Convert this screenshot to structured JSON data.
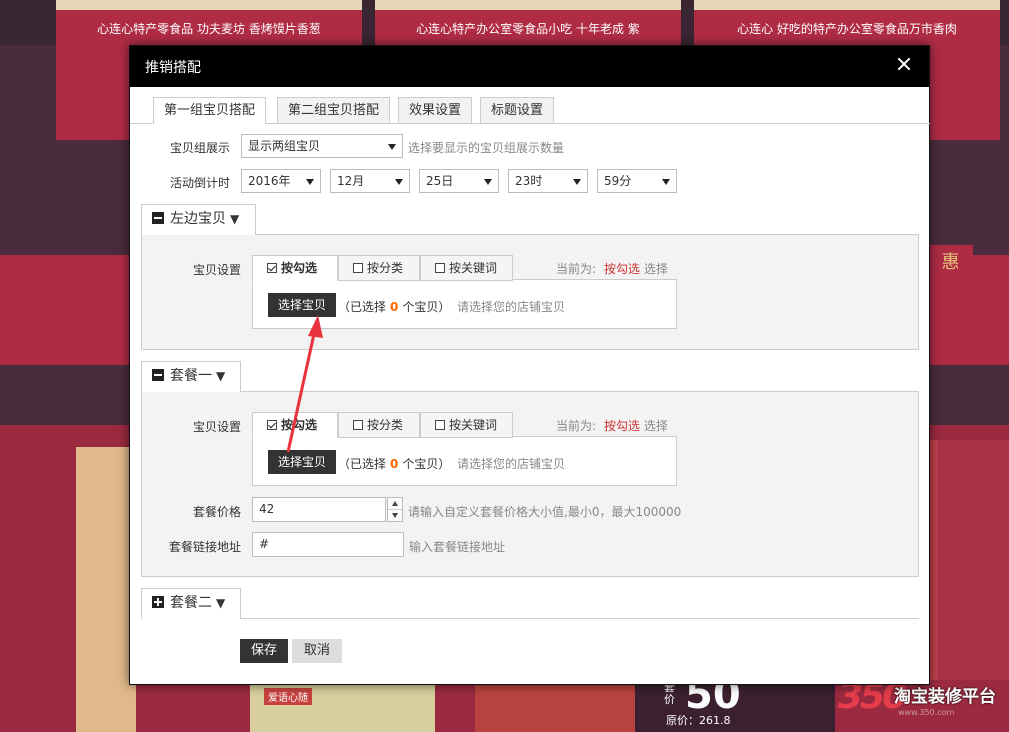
{
  "background": {
    "cards": [
      {
        "text": "心连心特产零食品 功夫麦坊 香烤馍片香葱"
      },
      {
        "text": "心连心特产办公室零食品小吃 十年老成 紫"
      },
      {
        "text": "心连心 好吃的特产办公室零食品万市香肉"
      }
    ],
    "tag": "惠",
    "box_label": "爱语心随",
    "price_label": "套价",
    "price_big": "50",
    "price_orig": "原价：261.8",
    "logo": {
      "number": "350",
      "text": "淘宝装修平台",
      "sub": "www.350.com"
    }
  },
  "modal": {
    "title": "推销搭配",
    "tabs": [
      "第一组宝贝搭配",
      "第二组宝贝搭配",
      "效果设置",
      "标题设置"
    ],
    "group_display": {
      "label": "宝贝组展示",
      "value": "显示两组宝贝",
      "hint": "选择要显示的宝贝组展示数量"
    },
    "countdown": {
      "label": "活动倒计时",
      "year": "2016年",
      "month": "12月",
      "day": "25日",
      "hour": "23时",
      "minute": "59分"
    },
    "left_section": {
      "title": "左边宝贝",
      "arrow": "▼",
      "setting_label": "宝贝设置",
      "sub_tabs": [
        "按勾选",
        "按分类",
        "按关键词"
      ],
      "current_prefix": "当前为:",
      "current_value": "按勾选",
      "current_suffix": "选择",
      "select_button": "选择宝贝",
      "selected_prefix": "（已选择",
      "selected_count": "0",
      "selected_suffix": "个宝贝）",
      "hint": "请选择您的店铺宝贝"
    },
    "package1": {
      "title": "套餐一",
      "arrow": "▼",
      "setting_label": "宝贝设置",
      "sub_tabs": [
        "按勾选",
        "按分类",
        "按关键词"
      ],
      "current_prefix": "当前为:",
      "current_value": "按勾选",
      "current_suffix": "选择",
      "select_button": "选择宝贝",
      "selected_prefix": "（已选择",
      "selected_count": "0",
      "selected_suffix": "个宝贝）",
      "hint": "请选择您的店铺宝贝",
      "price_label": "套餐价格",
      "price_value": "42",
      "price_hint": "请输入自定义套餐价格大小值,最小0，最大100000",
      "link_label": "套餐链接地址",
      "link_value": "#",
      "link_hint": "输入套餐链接地址"
    },
    "package2": {
      "title": "套餐二",
      "arrow": "▼"
    },
    "save_label": "保存",
    "cancel_label": "取消"
  },
  "annotation_color": "#e8323c"
}
